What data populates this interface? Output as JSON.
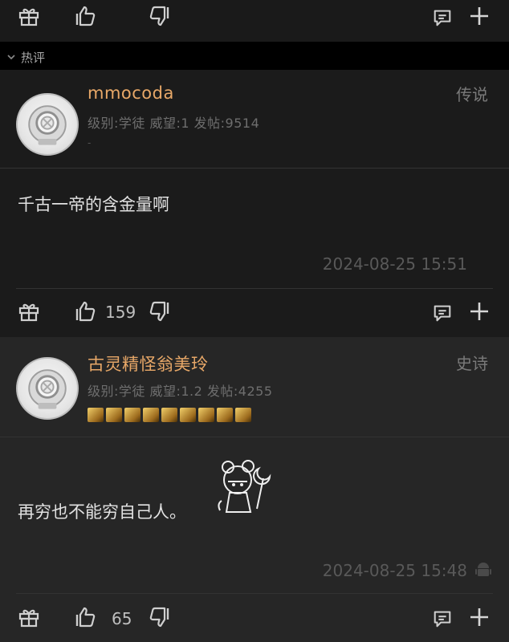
{
  "section": {
    "title": "热评"
  },
  "comments": [
    {
      "username": "mmocoda",
      "rank": "传说",
      "meta": "级别:学徒  威望:1  发帖:9514",
      "signature": "-",
      "body": "千古一帝的含金量啊",
      "timestamp": "2024-08-25 15:51",
      "likes": "159"
    },
    {
      "username": "古灵精怪翁美玲",
      "rank": "史诗",
      "meta": "级别:学徒  威望:1.2  发帖:4255",
      "badge_count": 9,
      "body": "再穷也不能穷自己人。",
      "timestamp": "2024-08-25 15:48",
      "likes": "65"
    }
  ],
  "icons": [
    "gift-icon",
    "thumbs-up-icon",
    "thumbs-down-icon",
    "comment-icon",
    "plus-icon",
    "avatar-diver-icon",
    "android-icon"
  ],
  "colors": {
    "username": "#e8a868",
    "rank": "#7a7a7a",
    "timestamp": "#595959"
  }
}
